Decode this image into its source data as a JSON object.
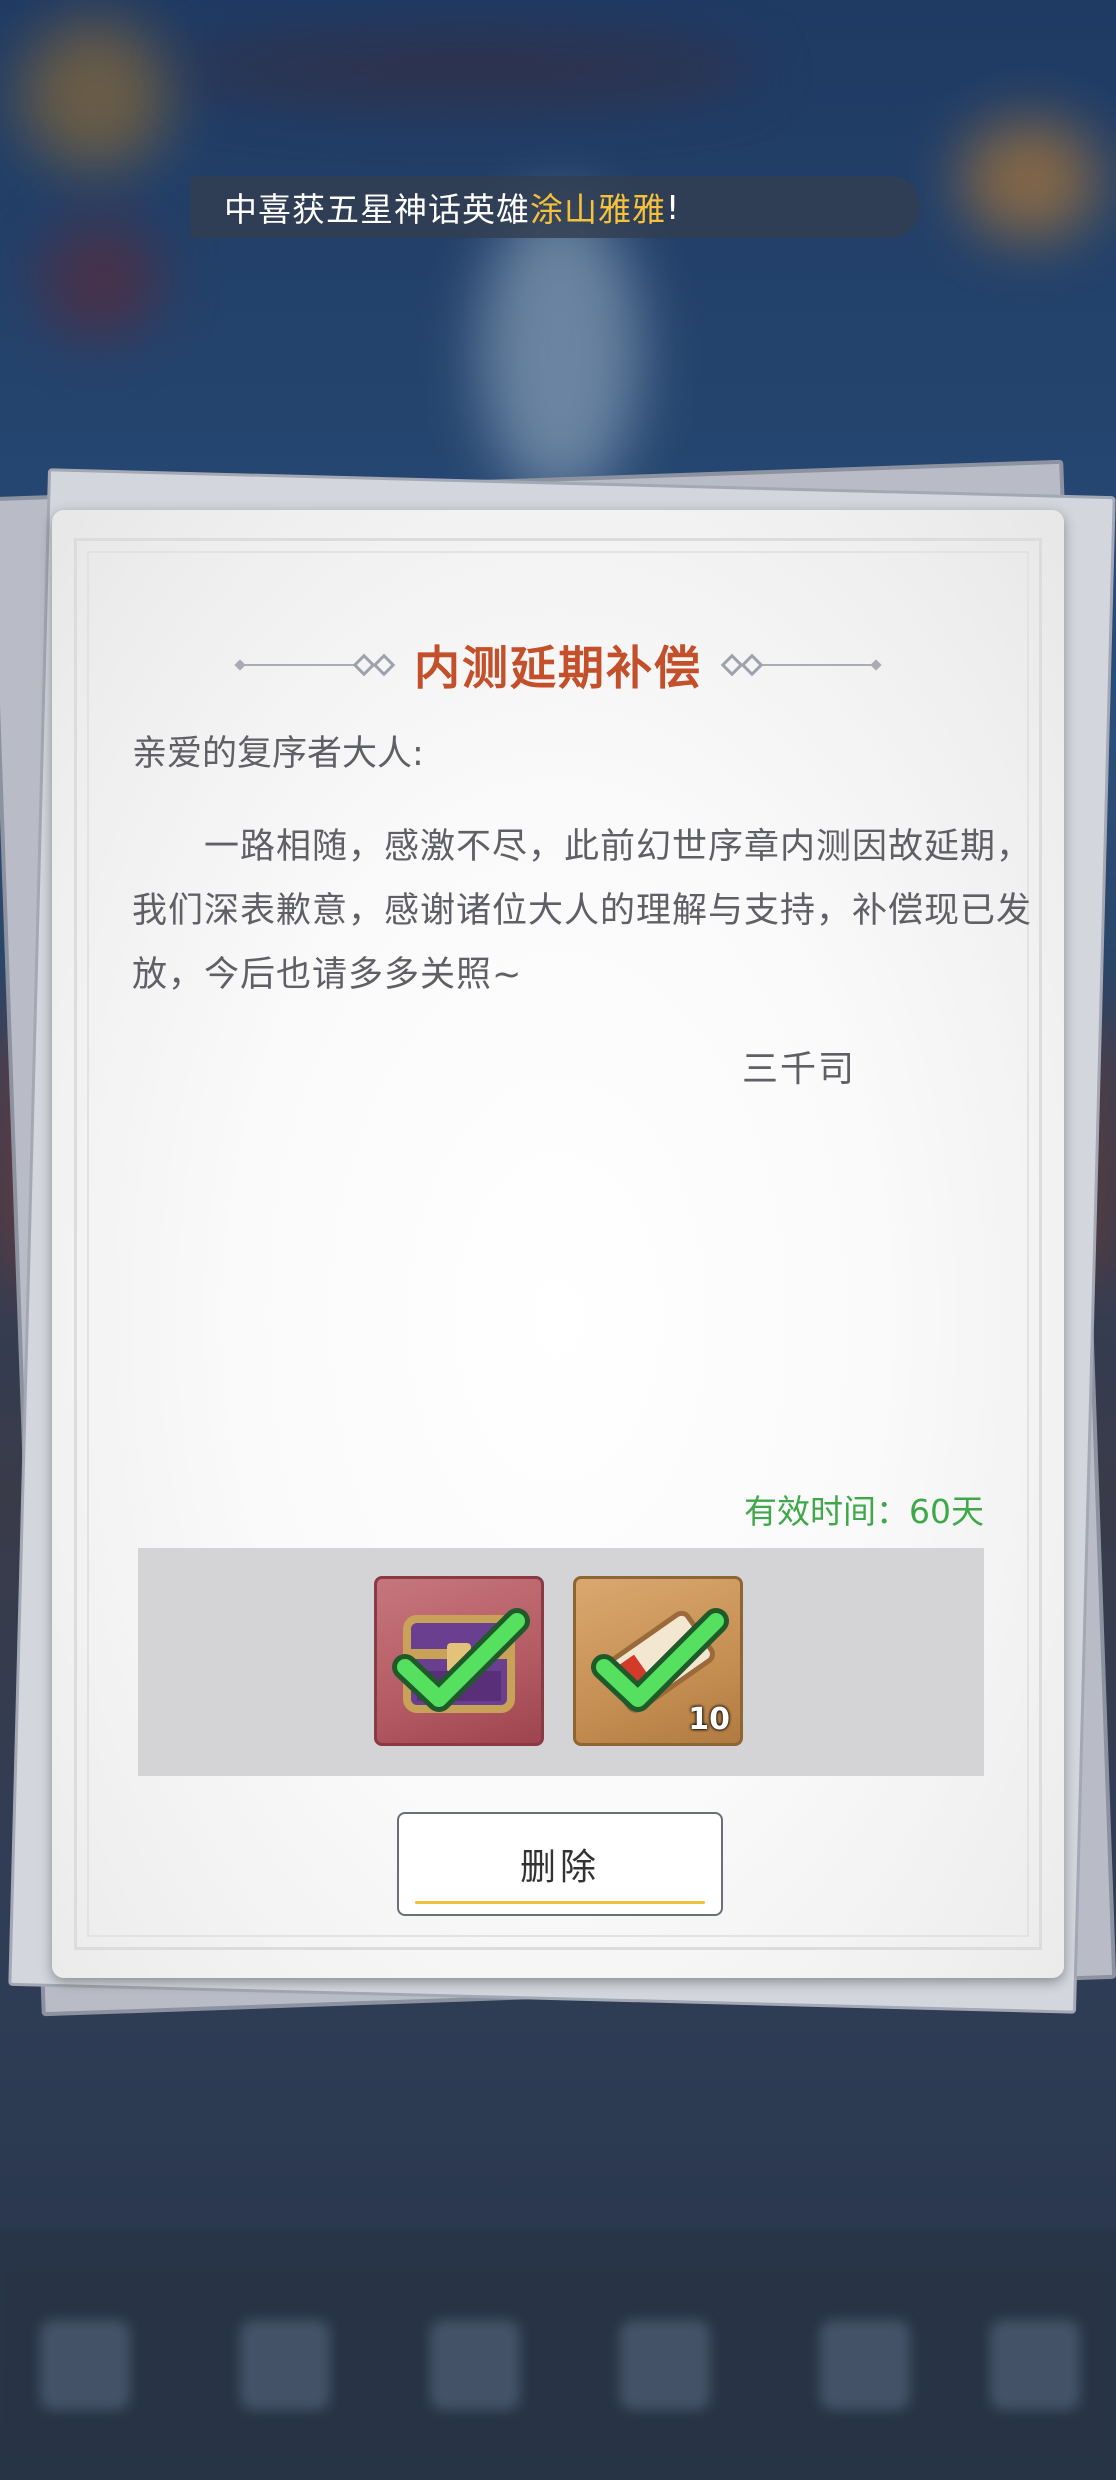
{
  "broadcast": {
    "prefix": "中喜获五星神话英雄",
    "hero_name": "涂山雅雅",
    "suffix": "!"
  },
  "mail": {
    "title": "内测延期补偿",
    "greeting": "亲爱的复序者大人:",
    "body": "一路相随，感激不尽，此前幻世序章内测因故延期，我们深表歉意，感谢诸位大人的理解与支持，补偿现已发放，今后也请多多关照~",
    "signature": "三千司",
    "validity_label": "有效时间：",
    "validity_value": "60天",
    "rewards": [
      {
        "icon": "treasure-chest-icon",
        "claimed": true,
        "count": ""
      },
      {
        "icon": "ticket-icon",
        "claimed": true,
        "count": "10"
      }
    ],
    "delete_label": "删除"
  },
  "colors": {
    "title": "#c3502b",
    "validity": "#3fa84a",
    "hero_highlight": "#f6c23c",
    "check": "#55e05f"
  }
}
